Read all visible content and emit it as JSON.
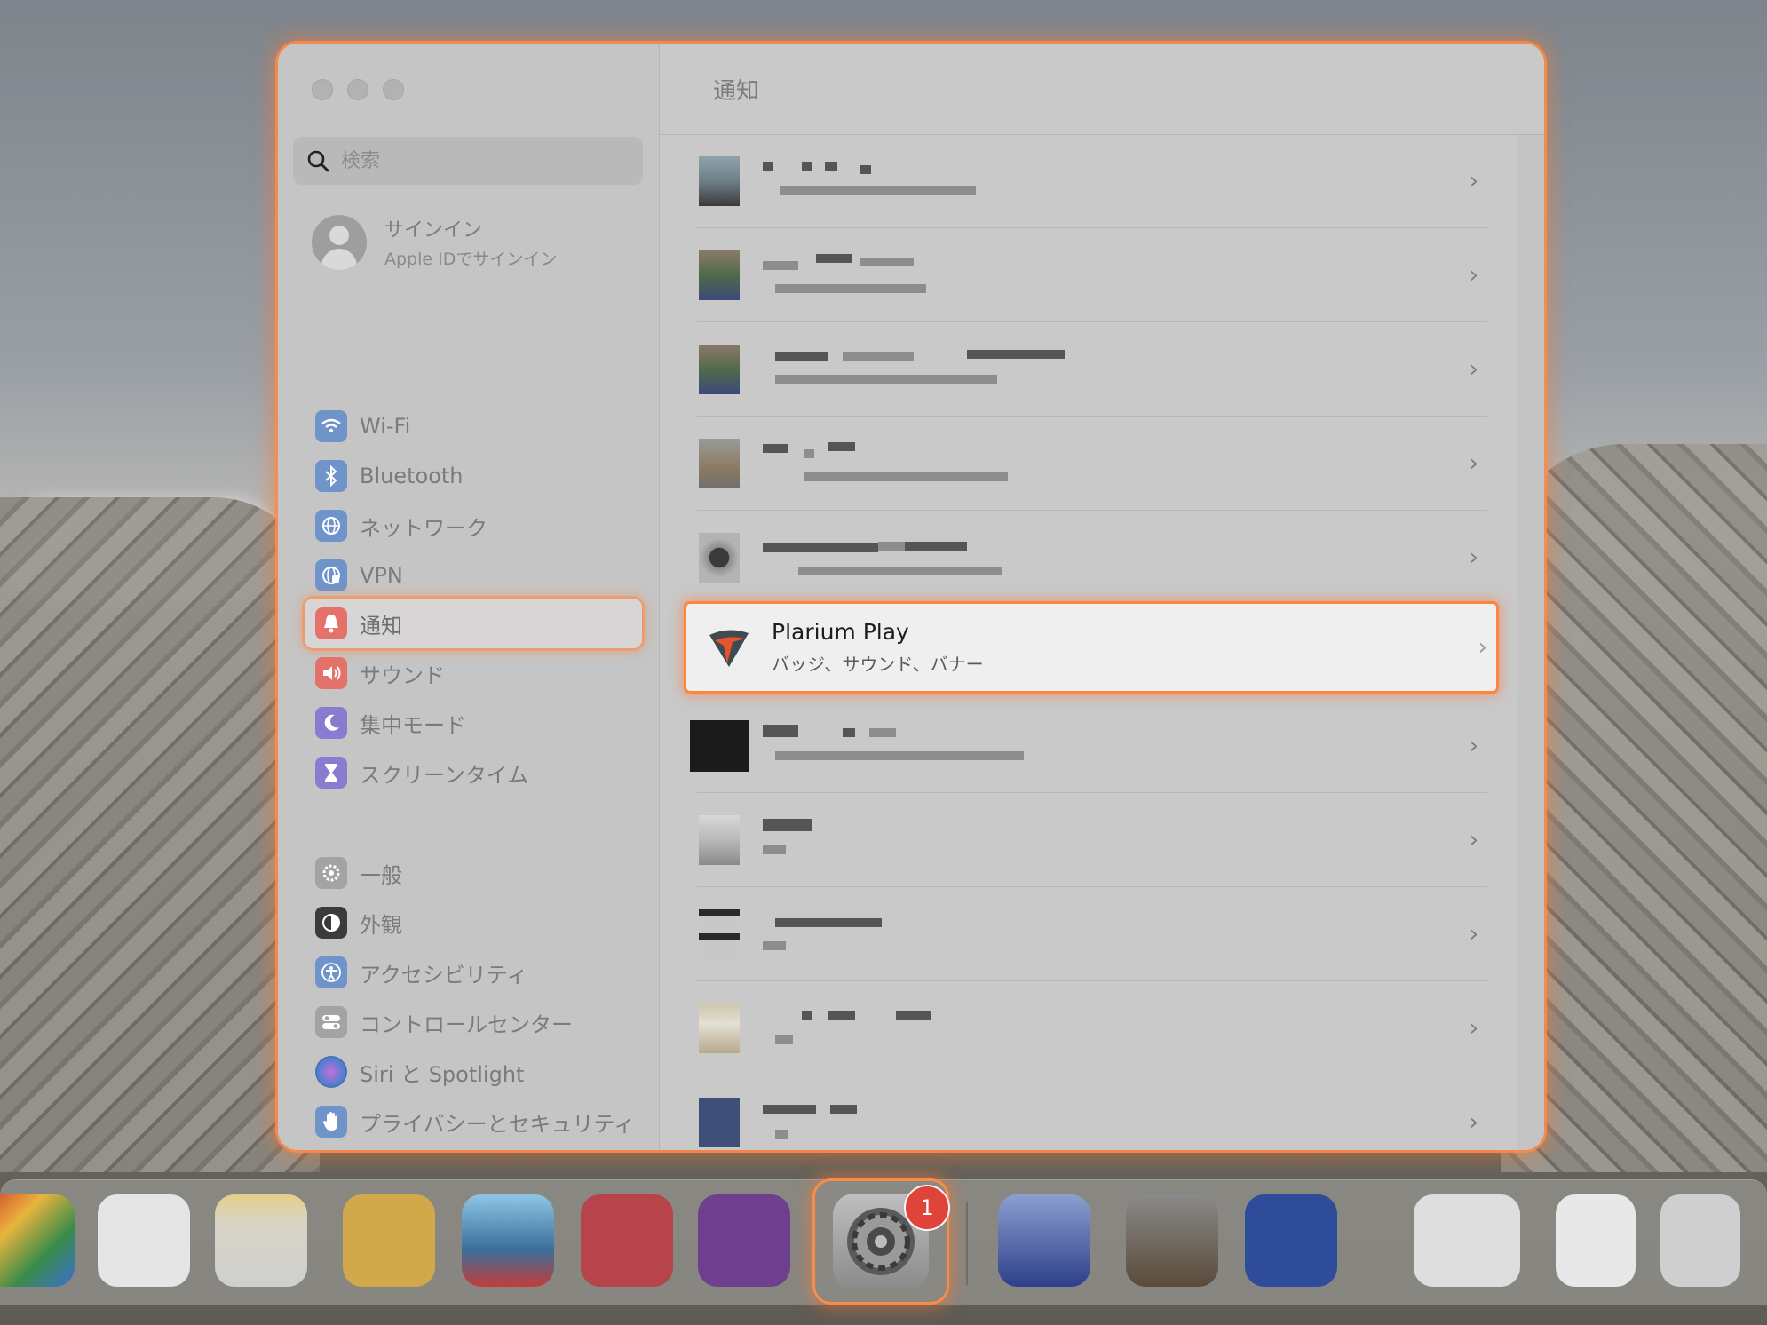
{
  "window": {
    "header_title": "通知"
  },
  "search": {
    "placeholder": "検索"
  },
  "signin": {
    "title": "サインイン",
    "subtitle": "Apple IDでサインイン"
  },
  "sidebar": {
    "items": [
      {
        "label": "Wi-Fi",
        "icon": "wifi-icon",
        "color": "#5b8fd8"
      },
      {
        "label": "Bluetooth",
        "icon": "bluetooth-icon",
        "color": "#5b8fd8"
      },
      {
        "label": "ネットワーク",
        "icon": "globe-icon",
        "color": "#5b8fd8"
      },
      {
        "label": "VPN",
        "icon": "vpn-globe-icon",
        "color": "#5b8fd8"
      },
      {
        "label": "通知",
        "icon": "bell-icon",
        "color": "#e0625a",
        "active": true
      },
      {
        "label": "サウンド",
        "icon": "speaker-icon",
        "color": "#e0625a"
      },
      {
        "label": "集中モード",
        "icon": "moon-icon",
        "color": "#7a67d0"
      },
      {
        "label": "スクリーンタイム",
        "icon": "hourglass-icon",
        "color": "#7a67d0"
      },
      {
        "label": "一般",
        "icon": "gear-icon",
        "color": "#9a9a9a"
      },
      {
        "label": "外観",
        "icon": "appearance-icon",
        "color": "#333333"
      },
      {
        "label": "アクセシビリティ",
        "icon": "accessibility-icon",
        "color": "#5b8fd8"
      },
      {
        "label": "コントロールセンター",
        "icon": "toggles-icon",
        "color": "#9a9a9a"
      },
      {
        "label": "Siri と Spotlight",
        "icon": "siri-icon",
        "color": "#8a6fc7"
      },
      {
        "label": "プライバシーとセキュリティ",
        "icon": "hand-icon",
        "color": "#5b8fd8"
      }
    ]
  },
  "apps": {
    "highlighted": {
      "name": "Plarium Play",
      "subtitle": "バッジ、サウンド、バナー"
    }
  },
  "dock": {
    "settings_badge": "1"
  },
  "colors": {
    "accent_glow": "#ff8c46",
    "badge_red": "#e0433a"
  }
}
